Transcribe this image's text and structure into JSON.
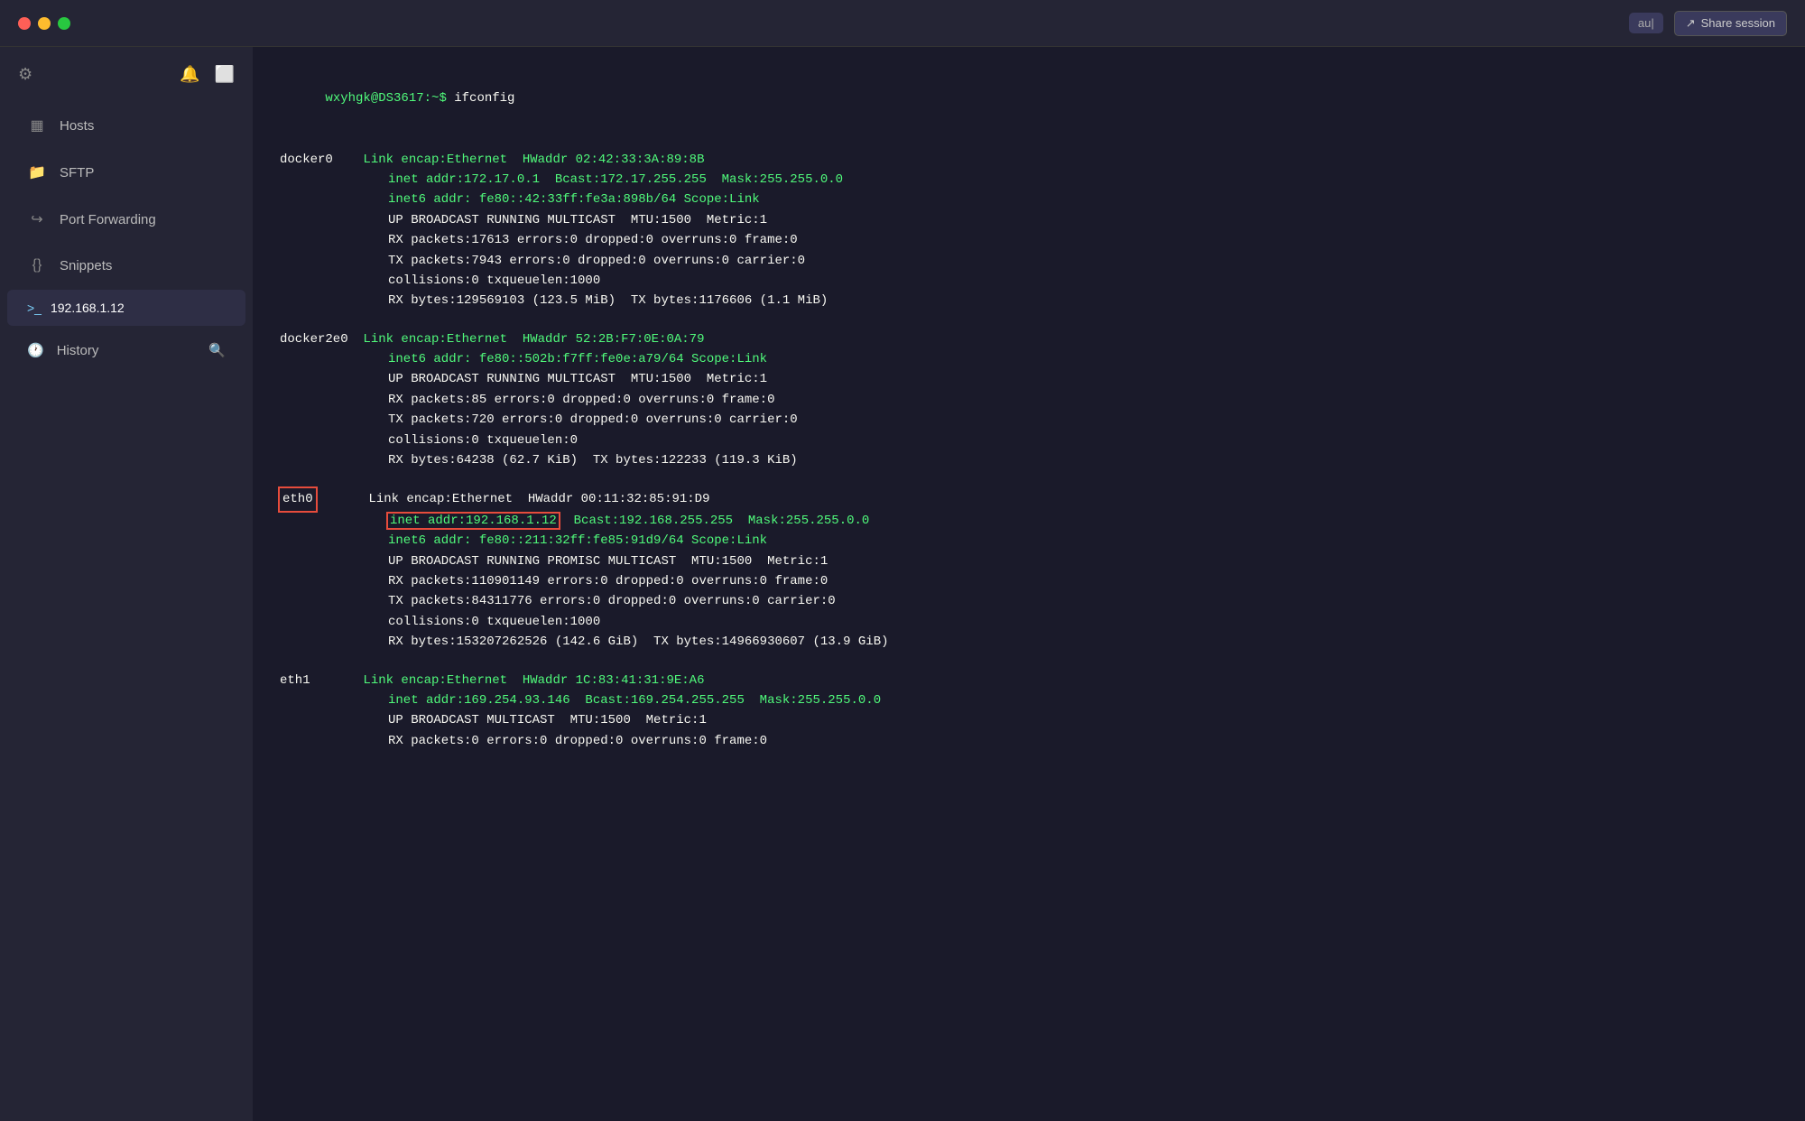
{
  "titlebar": {
    "user": "au|",
    "share_label": "Share session"
  },
  "sidebar": {
    "nav_items": [
      {
        "id": "hosts",
        "icon": "▦",
        "label": "Hosts"
      },
      {
        "id": "sftp",
        "icon": "📁",
        "label": "SFTP"
      },
      {
        "id": "port-forwarding",
        "icon": "↪",
        "label": "Port Forwarding"
      },
      {
        "id": "snippets",
        "icon": "{}",
        "label": "Snippets"
      }
    ],
    "connected_session": "192.168.1.12",
    "history_label": "History"
  },
  "terminal": {
    "prompt": "wxyhgk@DS3617:~$ ifconfig",
    "blocks": [
      {
        "iface": "docker0",
        "highlighted": false,
        "lines": [
          "Link encap:Ethernet  HWaddr 02:42:33:3A:89:8B",
          "inet addr:172.17.0.1  Bcast:172.17.255.255  Mask:255.255.0.0",
          "inet6 addr: fe80::42:33ff:fe3a:898b/64 Scope:Link",
          "UP BROADCAST RUNNING MULTICAST  MTU:1500  Metric:1",
          "RX packets:17613 errors:0 dropped:0 overruns:0 frame:0",
          "TX packets:7943 errors:0 dropped:0 overruns:0 carrier:0",
          "collisions:0 txqueuelen:1000",
          "RX bytes:129569103 (123.5 MiB)  TX bytes:1176606 (1.1 MiB)"
        ]
      },
      {
        "iface": "docker2e0",
        "highlighted": false,
        "lines": [
          "Link encap:Ethernet  HWaddr 52:2B:F7:0E:0A:79",
          "inet6 addr: fe80::502b:f7ff:fe0e:a79/64 Scope:Link",
          "UP BROADCAST RUNNING MULTICAST  MTU:1500  Metric:1",
          "RX packets:85 errors:0 dropped:0 overruns:0 frame:0",
          "TX packets:720 errors:0 dropped:0 overruns:0 carrier:0",
          "collisions:0 txqueuelen:0",
          "RX bytes:64238 (62.7 KiB)  TX bytes:122233 (119.3 KiB)"
        ]
      },
      {
        "iface": "eth0",
        "highlighted": true,
        "lines": [
          "Link encap:Ethernet  HWaddr 00:11:32:85:91:D9",
          "inet addr:192.168.1.12  Bcast:192.168.255.255  Mask:255.255.0.0",
          "inet6 addr: fe80::211:32ff:fe85:91d9/64 Scope:Link",
          "UP BROADCAST RUNNING PROMISC MULTICAST  MTU:1500  Metric:1",
          "RX packets:110901149 errors:0 dropped:0 overruns:0 frame:0",
          "TX packets:84311776 errors:0 dropped:0 overruns:0 carrier:0",
          "collisions:0 txqueuelen:1000",
          "RX bytes:153207262526 (142.6 GiB)  TX bytes:14966930607 (13.9 GiB)"
        ],
        "highlighted_line_index": 1,
        "highlighted_line_text": "inet addr:192.168.1.12"
      },
      {
        "iface": "eth1",
        "highlighted": false,
        "lines": [
          "Link encap:Ethernet  HWaddr 1C:83:41:31:9E:A6",
          "inet addr:169.254.93.146  Bcast:169.254.255.255  Mask:255.255.0.0",
          "UP BROADCAST MULTICAST  MTU:1500  Metric:1",
          "RX packets:0 errors:0 dropped:0 overruns:0 frame:0"
        ]
      }
    ]
  }
}
